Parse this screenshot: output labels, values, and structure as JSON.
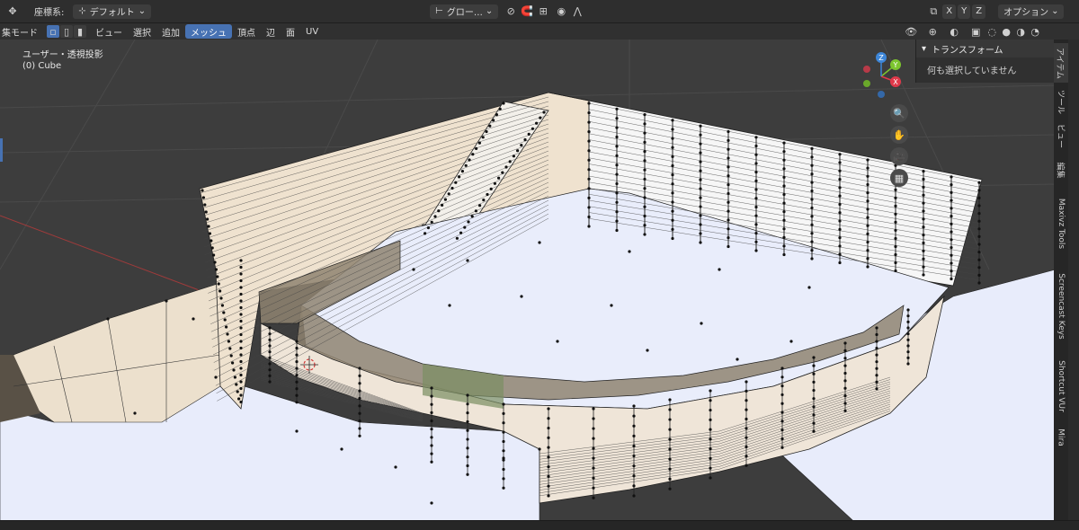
{
  "topbar": {
    "coord_label": "座標系:",
    "coord_value": "デフォルト",
    "orientation_value": "グロー…",
    "xyz": [
      "X",
      "Y",
      "Z"
    ],
    "options_label": "オプション"
  },
  "menubar": {
    "mode_label": "集モード",
    "items": [
      "ビュー",
      "選択",
      "追加",
      "メッシュ",
      "頂点",
      "辺",
      "面",
      "UV"
    ],
    "active_item": "メッシュ"
  },
  "viewport": {
    "view_name": "ユーザー・透視投影",
    "object_name": "(0) Cube",
    "axes": {
      "x": "X",
      "y": "Y",
      "z": "Z"
    },
    "axis_colors": {
      "x": "#e0394a",
      "y": "#7cc52e",
      "z": "#3d86d8"
    }
  },
  "npanel": {
    "header": "トランスフォーム",
    "message": "何も選択していません"
  },
  "sidetabs": [
    "アイテム",
    "ツール",
    "ビュー",
    "編集",
    "Maxivz Tools",
    "Screencast Keys",
    "Shortcut VUr",
    "Mira"
  ],
  "icons": {
    "zoom": "zoom-icon",
    "pan": "hand-icon",
    "camera": "camera-icon",
    "grid": "grid-icon"
  }
}
